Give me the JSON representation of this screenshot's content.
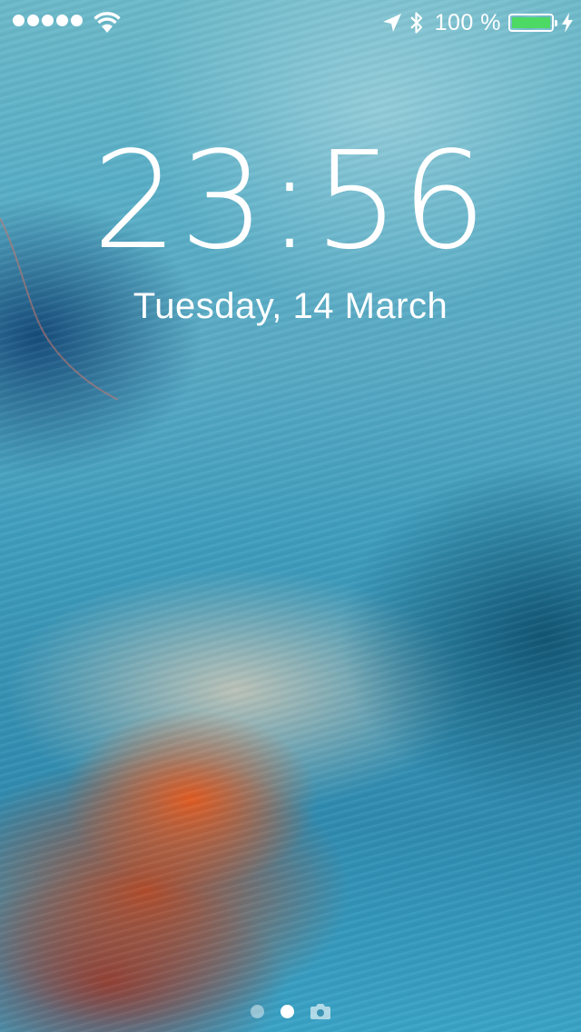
{
  "status_bar": {
    "signal_bars": 5,
    "signal_icon": "signal-dots-icon",
    "wifi_icon": "wifi-icon",
    "location_icon": "location-arrow-icon",
    "bluetooth_icon": "bluetooth-icon",
    "battery_percent_text": "100 %",
    "battery_level": 1.0,
    "battery_color": "#4cd964",
    "charging_icon": "charging-bolt-icon"
  },
  "lock_screen": {
    "time": "23:56",
    "date": "Tuesday, 14 March"
  },
  "page_indicator": {
    "pages": 2,
    "active_index": 1,
    "camera_icon": "camera-icon"
  }
}
